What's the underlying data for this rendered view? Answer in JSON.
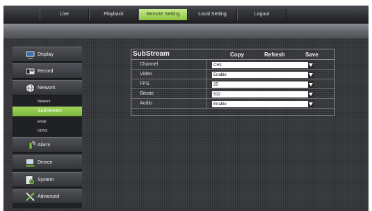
{
  "nav": {
    "tabs": [
      {
        "label": "Live"
      },
      {
        "label": "Playback"
      },
      {
        "label": "Remote Setting"
      },
      {
        "label": "Local Setting"
      },
      {
        "label": "Logout"
      }
    ],
    "active_tab": "Remote Setting",
    "accent": "#9ccf52"
  },
  "sidebar": {
    "items": [
      {
        "label": "Display",
        "icon": "monitor-icon"
      },
      {
        "label": "Record",
        "icon": "camera-icon"
      },
      {
        "label": "Network",
        "icon": "network-globe-icon"
      },
      {
        "label": "Alarm",
        "icon": "alarm-icon"
      },
      {
        "label": "Device",
        "icon": "hard-disk-icon"
      },
      {
        "label": "System",
        "icon": "system-icon"
      },
      {
        "label": "Advanced",
        "icon": "tools-icon"
      }
    ],
    "subitems": [
      {
        "label": "Network"
      },
      {
        "label": "SubStream"
      },
      {
        "label": "Email"
      },
      {
        "label": "DDNS"
      }
    ]
  },
  "panel": {
    "title": "SubStream",
    "copy_label": "Copy",
    "refresh_label": "Refresh",
    "save_label": "Save",
    "rows": [
      {
        "label": "Channel",
        "value": "CH1"
      },
      {
        "label": "Video",
        "value": "Enable"
      },
      {
        "label": "FPS",
        "value": "25"
      },
      {
        "label": "Bitrate",
        "value": "512"
      },
      {
        "label": "Audio",
        "value": "Enable"
      }
    ]
  }
}
